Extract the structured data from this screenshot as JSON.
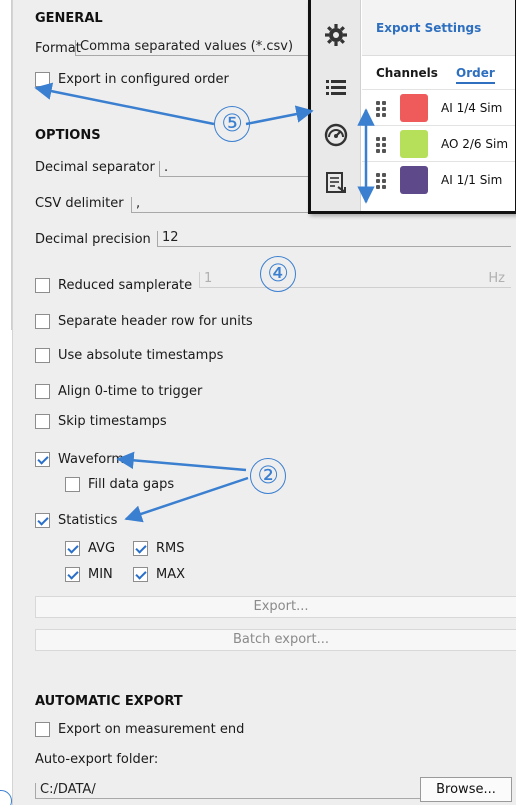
{
  "general": {
    "title": "GENERAL",
    "format_label": "Format",
    "format_value": "Comma separated values (*.csv)",
    "export_order_label": "Export in configured order"
  },
  "options": {
    "title": "OPTIONS",
    "decimal_separator_label": "Decimal separator",
    "decimal_separator_value": ".",
    "csv_delimiter_label": "CSV delimiter",
    "csv_delimiter_value": ",",
    "decimal_precision_label": "Decimal precision",
    "decimal_precision_value": "12",
    "reduced_samplerate_label": "Reduced samplerate",
    "reduced_samplerate_value": "1",
    "reduced_samplerate_unit": "Hz",
    "header_row_units_label": "Separate header row for units",
    "absolute_timestamps_label": "Use absolute timestamps",
    "align_zero_label": "Align 0-time to trigger",
    "skip_timestamps_label": "Skip timestamps",
    "waveform_label": "Waveform",
    "fill_gaps_label": "Fill data gaps",
    "statistics_label": "Statistics",
    "avg_label": "AVG",
    "rms_label": "RMS",
    "min_label": "MIN",
    "max_label": "MAX"
  },
  "buttons": {
    "export": "Export...",
    "batch_export": "Batch export..."
  },
  "auto_export": {
    "title": "AUTOMATIC EXPORT",
    "on_end_label": "Export on measurement end",
    "folder_label": "Auto-export folder:",
    "folder_value": "C:/DATA/",
    "browse": "Browse..."
  },
  "popup": {
    "title": "Export Settings",
    "tab_channels": "Channels",
    "tab_order": "Order",
    "channels": [
      {
        "name": "AI 1/4 Sim",
        "color": "#ef5b5b"
      },
      {
        "name": "AO 2/6 Sim",
        "color": "#b6e05a"
      },
      {
        "name": "AI 1/1 Sim",
        "color": "#5e4a8a"
      }
    ]
  },
  "callouts": {
    "c2": "②",
    "c4": "④",
    "c5": "⑤"
  },
  "colors": {
    "accent": "#2e6fbf",
    "arrow": "#3a7fd0"
  }
}
